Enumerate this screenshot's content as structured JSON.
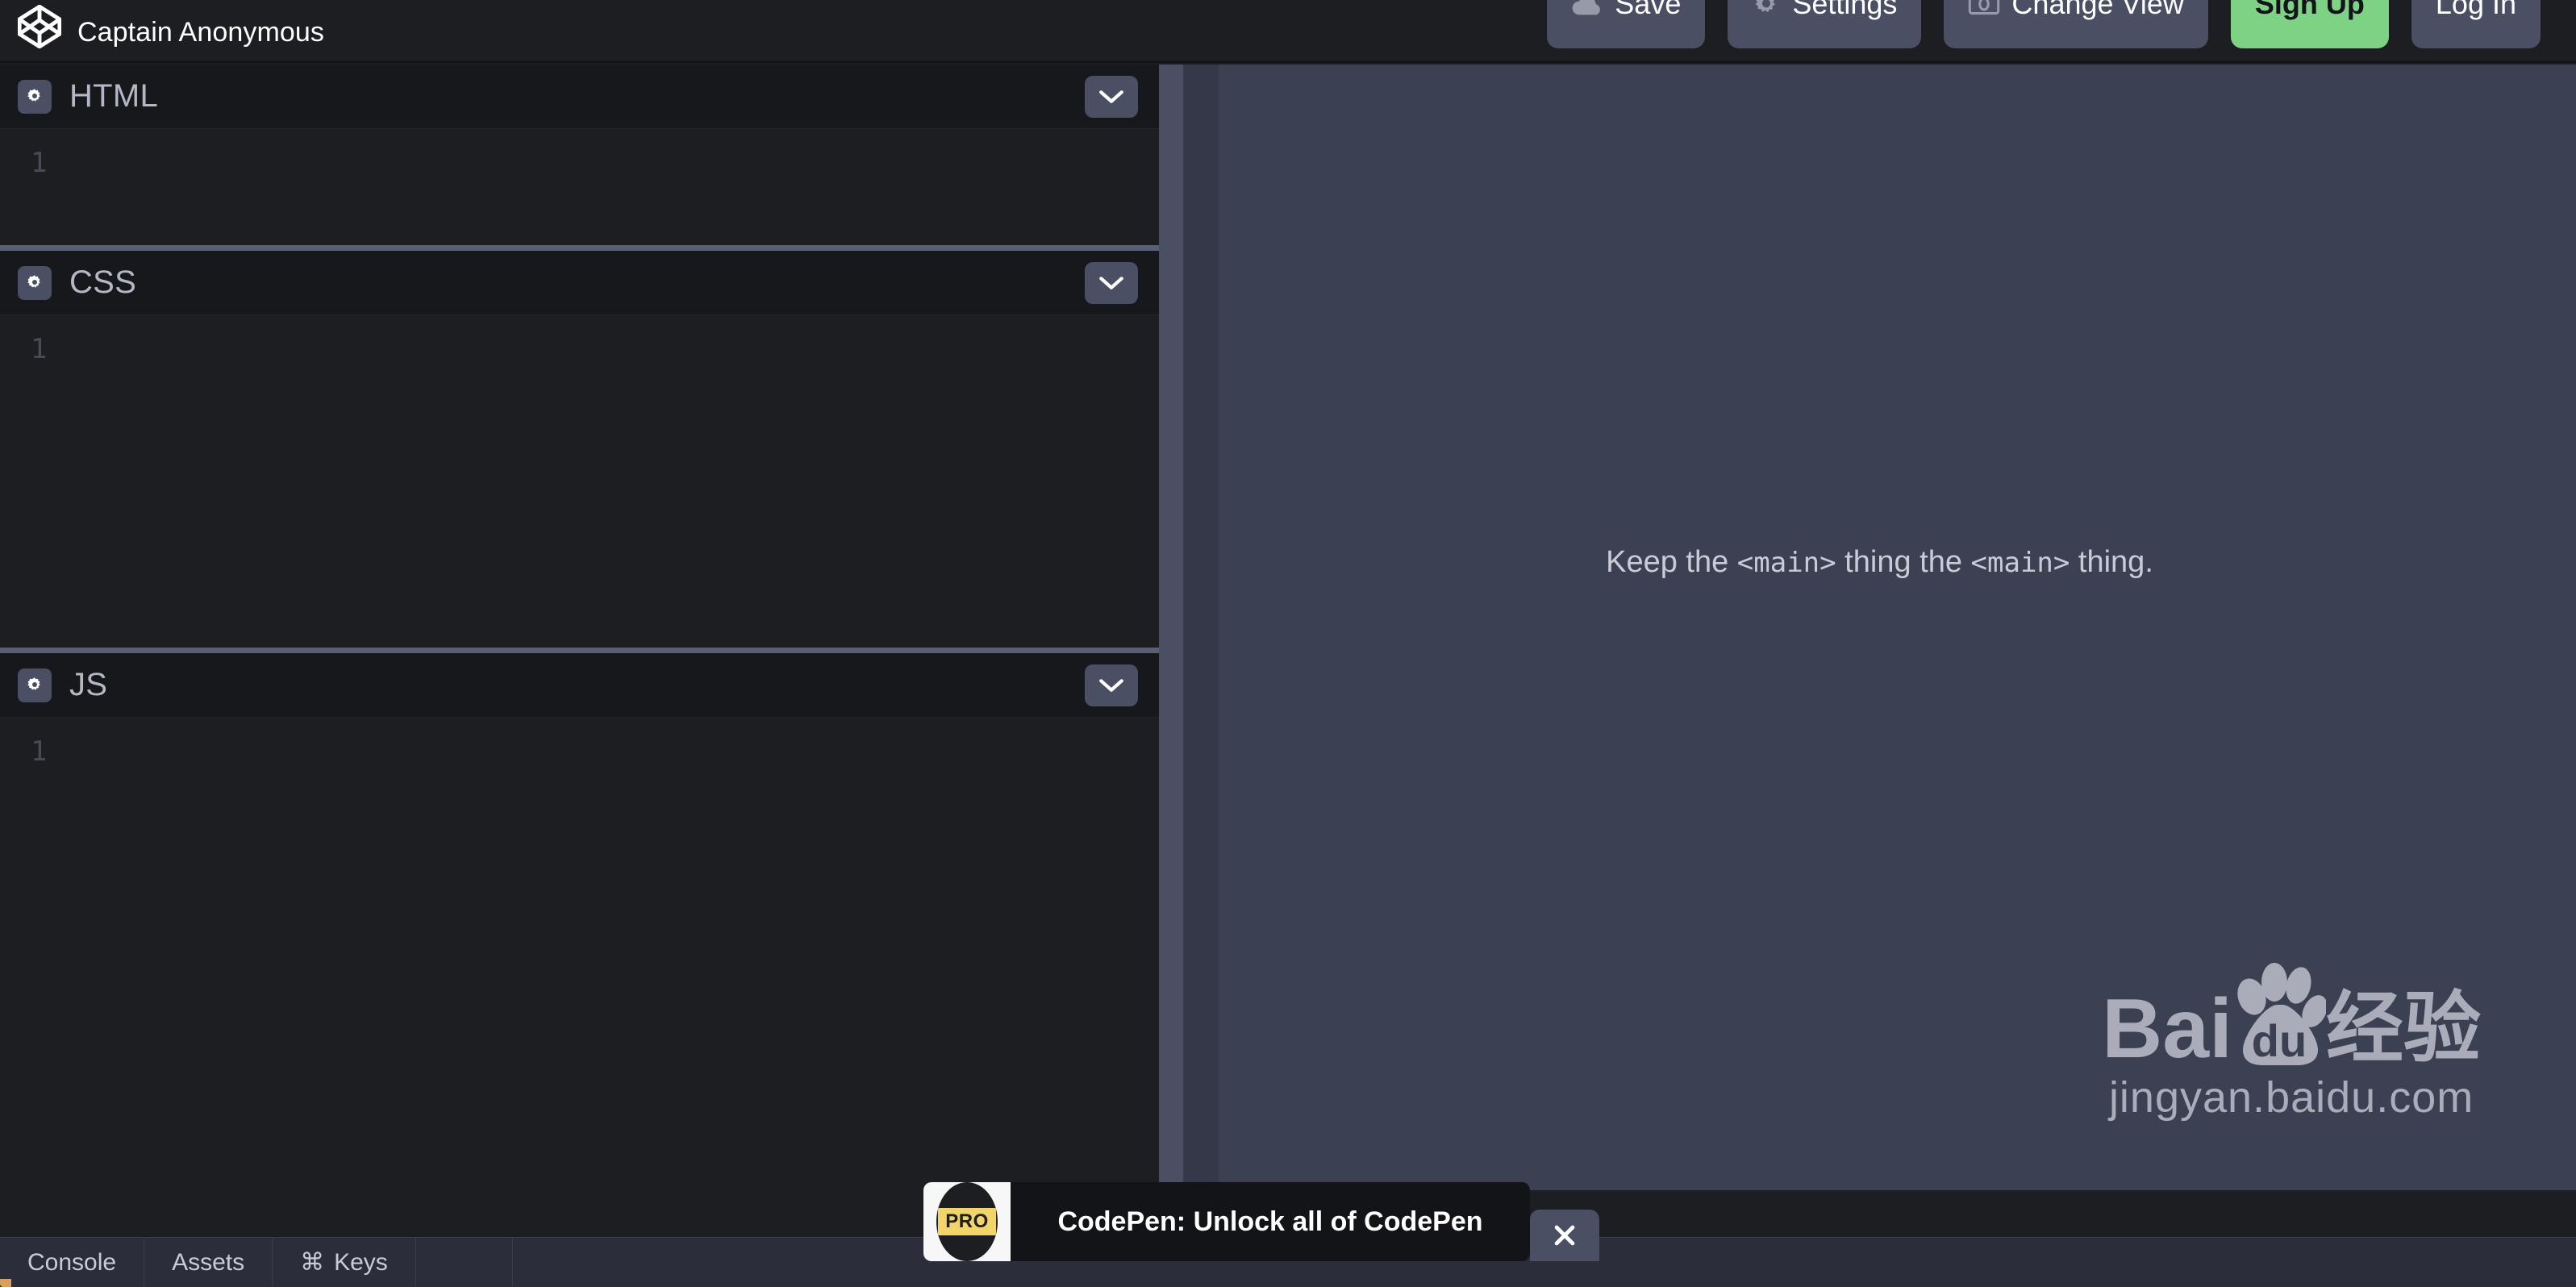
{
  "header": {
    "brand_name": "Captain Anonymous",
    "logo_icon": "codepen-logo-icon",
    "actions": [
      {
        "label": "Save",
        "icon": "cloud-icon",
        "style": "default"
      },
      {
        "label": "Settings",
        "icon": "gear-icon",
        "style": "default"
      },
      {
        "label": "Change View",
        "icon": "monitor-icon",
        "style": "default"
      },
      {
        "label": "Sign Up",
        "icon": "",
        "style": "primary"
      },
      {
        "label": "Log In",
        "icon": "",
        "style": "default"
      }
    ]
  },
  "editors": [
    {
      "title": "HTML",
      "settings_icon": "gear-icon",
      "collapse_icon": "chevron-down-icon",
      "line_number": "1",
      "content": ""
    },
    {
      "title": "CSS",
      "settings_icon": "gear-icon",
      "collapse_icon": "chevron-down-icon",
      "line_number": "1",
      "content": ""
    },
    {
      "title": "JS",
      "settings_icon": "gear-icon",
      "collapse_icon": "chevron-down-icon",
      "line_number": "1",
      "content": ""
    }
  ],
  "preview": {
    "text_before": "Keep the ",
    "code_one": "<main>",
    "text_middle": " thing the ",
    "code_two": "<main>",
    "text_after": " thing.",
    "watermark": {
      "brand_bai": "Bai",
      "brand_du": "du",
      "brand_cn": "经验",
      "url": "jingyan.baidu.com",
      "paw_icon": "baidu-paw-icon"
    }
  },
  "bottom_bar": {
    "items": [
      {
        "label": "Console",
        "icon": ""
      },
      {
        "label": "Assets",
        "icon": ""
      },
      {
        "label": "Keys",
        "icon": "command-icon",
        "icon_glyph": "⌘"
      }
    ]
  },
  "pro_banner": {
    "badge_label": "PRO",
    "message": "CodePen: Unlock all of CodePen",
    "close_icon": "close-icon",
    "close_glyph": "✕"
  },
  "colors": {
    "header_bg": "#1d1e22",
    "editor_bg": "#1d1e22",
    "pane_head_bg": "#17181c",
    "preview_bg": "#3c4053",
    "accent_green": "#7ed283",
    "control_gray": "#4a4f63",
    "bottom_bar_bg": "#2b2e3a",
    "pro_yellow": "#f2d46b",
    "gutter_text": "#484b55"
  }
}
